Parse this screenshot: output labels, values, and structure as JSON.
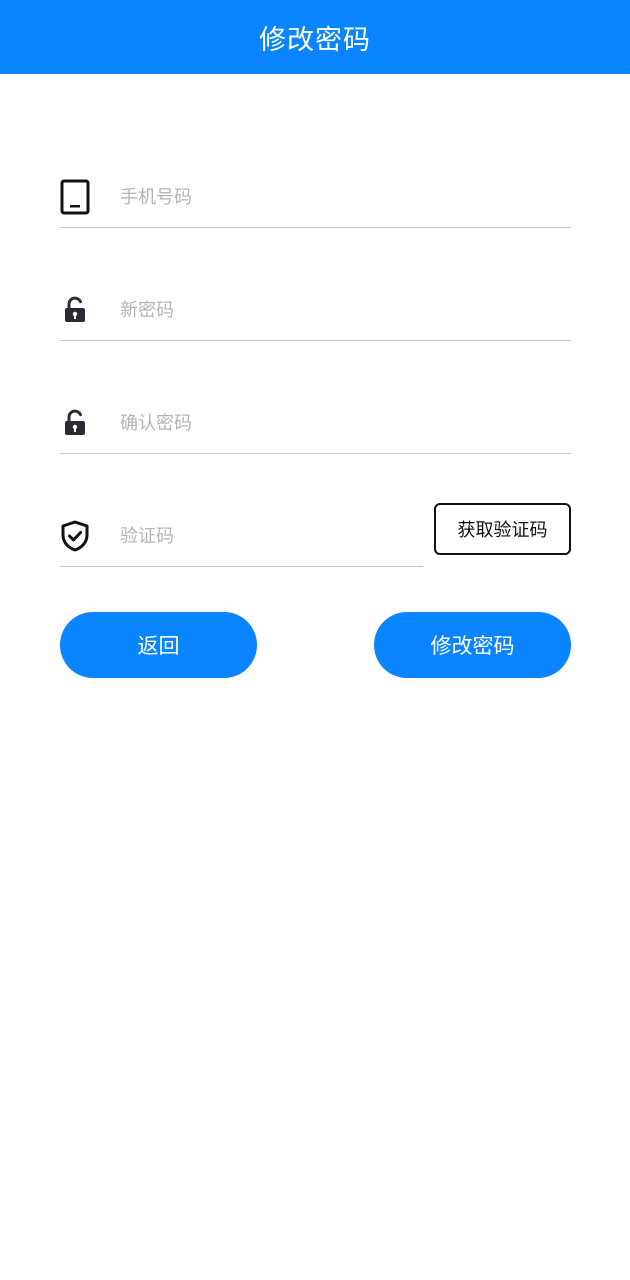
{
  "header": {
    "title": "修改密码"
  },
  "form": {
    "phone": {
      "placeholder": "手机号码",
      "value": "",
      "icon": "phone-icon"
    },
    "new_password": {
      "placeholder": "新密码",
      "value": "",
      "icon": "lock-icon"
    },
    "confirm_password": {
      "placeholder": "确认密码",
      "value": "",
      "icon": "lock-icon"
    },
    "verification_code": {
      "placeholder": "验证码",
      "value": "",
      "icon": "shield-check-icon"
    }
  },
  "buttons": {
    "get_code": "获取验证码",
    "back": "返回",
    "submit": "修改密码"
  },
  "colors": {
    "accent": "#0a84ff",
    "placeholder": "#b4b4b4",
    "divider": "#c8c8c8",
    "icon": "#111111"
  }
}
